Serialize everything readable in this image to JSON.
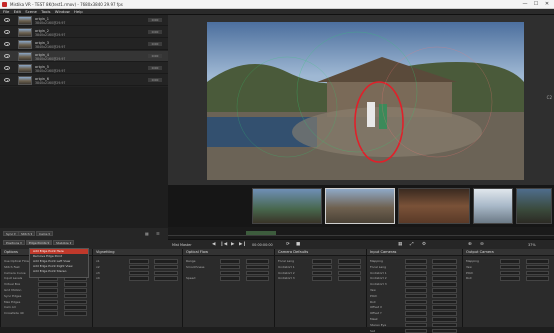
{
  "app": {
    "title": "Mistika VR - TEST 8K(test1.rmov) - 7680x3840 29.97 fps",
    "win_buttons": [
      "—",
      "☐",
      "✕"
    ]
  },
  "menu": [
    "File",
    "Edit",
    "Scene",
    "Tools",
    "Window",
    "Help"
  ],
  "clips": [
    {
      "name": "origin_1",
      "res": "3840x2160@29.97",
      "badge": "0:00"
    },
    {
      "name": "origin_2",
      "res": "3840x2160@29.97",
      "badge": "0:00"
    },
    {
      "name": "origin_3",
      "res": "3840x2160@29.97",
      "badge": "0:00"
    },
    {
      "name": "origin_4",
      "res": "3840x2160@29.97",
      "badge": "0:00"
    },
    {
      "name": "origin_5",
      "res": "3840x2160@29.97",
      "badge": "0:00"
    },
    {
      "name": "origin_6",
      "res": "3840x2160@29.97",
      "badge": "0:00"
    }
  ],
  "leftbar": {
    "row1": [
      "Sync ▾",
      "Stitch ▾",
      "Cams ▾"
    ],
    "row2": [
      "Positions ▾",
      "Edge Points ▾",
      "Stabilize ▾"
    ]
  },
  "dropdown": {
    "items": [
      "Add Edge Point Here",
      "Remove Edge Point",
      "Add Edge Point Left View",
      "Add Edge Point Right View",
      "Add Edge Point Stereo"
    ]
  },
  "controls": {
    "label": "Mist Master",
    "timecode": "00:00:00:00",
    "zoom": "37%"
  },
  "panels": [
    {
      "title": "Options",
      "rows": [
        "Use Optical Flow",
        "Stitch Fast",
        "Camera Curve",
        "Input Levels",
        "Virtual Box",
        "Grid Motion",
        "Sync Edges",
        "Max Edges",
        "Cam All",
        "Crossfade 40"
      ]
    },
    {
      "title": "Vignetting",
      "rows": [
        "x1",
        "x2",
        "x3",
        "x4"
      ]
    },
    {
      "title": "Optical Flow",
      "rows": [
        "Range",
        "Smoothness",
        "",
        "Speed"
      ]
    },
    {
      "title": "Camera Defaults",
      "rows": [
        "Focal Lang",
        "Undistort 1",
        "Undistort 2",
        "Undistort 3"
      ]
    },
    {
      "title": "Input Cameras",
      "rows": [
        "Mapping",
        "Focal Lang",
        "Undistort 1",
        "Undistort 2",
        "Undistort 3",
        "Yaw",
        "Pitch",
        "Roll",
        "Offset X",
        "Offset Y",
        "Mask",
        "Stereo Eye",
        "Sat"
      ]
    },
    {
      "title": "Output Camera",
      "rows": [
        "Mapping",
        "Yaw",
        "Pitch",
        "Roll"
      ]
    }
  ],
  "viewer": {
    "side_icons": "C2"
  }
}
